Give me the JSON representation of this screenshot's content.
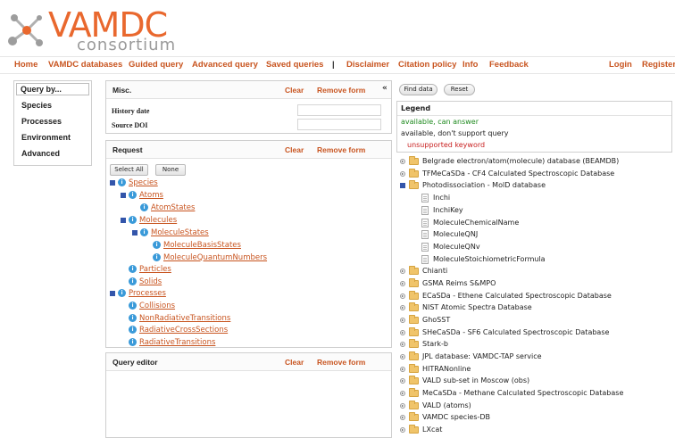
{
  "logo": {
    "brand": "VAMDC",
    "subtitle": "consortium"
  },
  "nav": {
    "left": [
      "Home",
      "VAMDC databases",
      "Guided query",
      "Advanced query",
      "Saved queries",
      "|",
      "Disclaimer",
      "Citation policy",
      "Info",
      "Feedback"
    ],
    "login": "Login",
    "register": "Register"
  },
  "query_by": {
    "title": "Query by...",
    "items": [
      "Species",
      "Processes",
      "Environment",
      "Advanced"
    ]
  },
  "misc_panel": {
    "title": "Misc.",
    "clear": "Clear",
    "remove": "Remove form",
    "collapse": "«",
    "rows": [
      "History date",
      "Source DOI"
    ]
  },
  "request_panel": {
    "title": "Request",
    "clear": "Clear",
    "remove": "Remove form",
    "select_all": "Select All",
    "none": "None",
    "tree": [
      "Species",
      "Atoms",
      "AtomStates",
      "Molecules",
      "MoleculeStates",
      "MoleculeBasisStates",
      "MoleculeQuantumNumbers",
      "Particles",
      "Solids",
      "Processes",
      "Collisions",
      "NonRadiativeTransitions",
      "RadiativeCrossSections",
      "RadiativeTransitions"
    ]
  },
  "editor_panel": {
    "title": "Query editor",
    "clear": "Clear",
    "remove": "Remove form"
  },
  "right": {
    "find_data": "Find data",
    "reset": "Reset",
    "legend": {
      "title": "Legend",
      "items": [
        "available, can answer",
        "available, don't support query",
        "unsupported keyword"
      ],
      "colors": [
        "#1f8a1f",
        "#222222",
        "#c81e1e"
      ]
    },
    "databases": [
      "Belgrade electron/atom(molecule) database (BEAMDB)",
      "TFMeCaSDa - CF4 Calculated Spectroscopic Database",
      "Photodissociation - MolD database",
      "Inchi",
      "InchiKey",
      "MoleculeChemicalName",
      "MoleculeQNJ",
      "MoleculeQNv",
      "MoleculeStoichiometricFormula",
      "Chianti",
      "GSMA Reims S&MPO",
      "ECaSDa - Ethene Calculated Spectroscopic Database",
      "NIST Atomic Spectra Database",
      "GhoSST",
      "SHeCaSDa - SF6 Calculated Spectroscopic Database",
      "Stark-b",
      "JPL database: VAMDC-TAP service",
      "HITRANonline",
      "VALD sub-set in Moscow (obs)",
      "MeCaSDa - Methane Calculated Spectroscopic Database",
      "VALD (atoms)",
      "VAMDC species-DB",
      "LXcat"
    ]
  },
  "colors": {
    "accent": "#c8541f",
    "tree_icon": "#3a9ad9",
    "selected": "#3355aa"
  }
}
